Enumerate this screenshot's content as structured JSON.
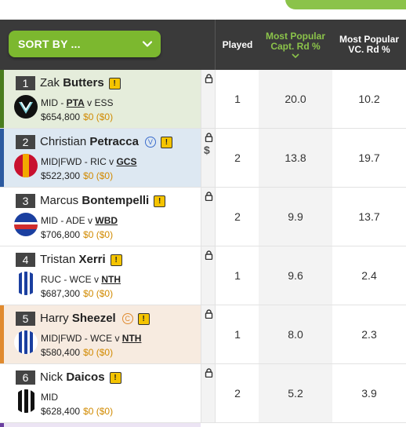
{
  "header": {
    "sort_label": "SORT BY ...",
    "col_played": "Played",
    "col_capt_line1": "Most Popular",
    "col_capt_line2": "Capt. Rd %",
    "col_vc_line1": "Most Popular",
    "col_vc_line2": "VC. Rd %"
  },
  "colors": {
    "accent_green": "#7cb82f",
    "header_bg": "#3a3a3a",
    "warning": "#f5c400",
    "price_change": "#d18a00"
  },
  "players": [
    {
      "rank": "1",
      "first": "Zak",
      "last": "Butters",
      "badge": "",
      "pos": "MID",
      "team": "PTA",
      "vs": "v",
      "opp": "ESS",
      "underline": "team",
      "price": "$654,800",
      "change": "$0 ($0)",
      "played": "1",
      "capt": "20.0",
      "vc": "10.2",
      "bar": "#4a7d1e",
      "panel": "#e5eddb",
      "dollar": false
    },
    {
      "rank": "2",
      "first": "Christian",
      "last": "Petracca",
      "badge": "V",
      "pos": "MID|FWD",
      "team": "RIC",
      "vs": "v",
      "opp": "GCS",
      "underline": "opp",
      "price": "$522,300",
      "change": "$0 ($0)",
      "played": "2",
      "capt": "13.8",
      "vc": "19.7",
      "bar": "#2c5aa0",
      "panel": "#dde8f2",
      "dollar": true
    },
    {
      "rank": "3",
      "first": "Marcus",
      "last": "Bontempelli",
      "badge": "",
      "pos": "MID",
      "team": "ADE",
      "vs": "v",
      "opp": "WBD",
      "underline": "opp",
      "price": "$706,800",
      "change": "$0 ($0)",
      "played": "2",
      "capt": "9.9",
      "vc": "13.7",
      "bar": "",
      "panel": "#ffffff",
      "dollar": false
    },
    {
      "rank": "4",
      "first": "Tristan",
      "last": "Xerri",
      "badge": "",
      "pos": "RUC",
      "team": "WCE",
      "vs": "v",
      "opp": "NTH",
      "underline": "opp",
      "price": "$687,300",
      "change": "$0 ($0)",
      "played": "1",
      "capt": "9.6",
      "vc": "2.4",
      "bar": "",
      "panel": "#ffffff",
      "dollar": false
    },
    {
      "rank": "5",
      "first": "Harry",
      "last": "Sheezel",
      "badge": "C",
      "pos": "MID|FWD",
      "team": "WCE",
      "vs": "v",
      "opp": "NTH",
      "underline": "opp",
      "price": "$580,400",
      "change": "$0 ($0)",
      "played": "1",
      "capt": "8.0",
      "vc": "2.3",
      "bar": "#e08a2e",
      "panel": "#f7ebe0",
      "dollar": false
    },
    {
      "rank": "6",
      "first": "Nick",
      "last": "Daicos",
      "badge": "",
      "pos": "MID",
      "team": "",
      "vs": "",
      "opp": "",
      "underline": "",
      "price": "$628,400",
      "change": "$0 ($0)",
      "played": "2",
      "capt": "5.2",
      "vc": "3.9",
      "bar": "",
      "panel": "#ffffff",
      "dollar": false
    }
  ]
}
